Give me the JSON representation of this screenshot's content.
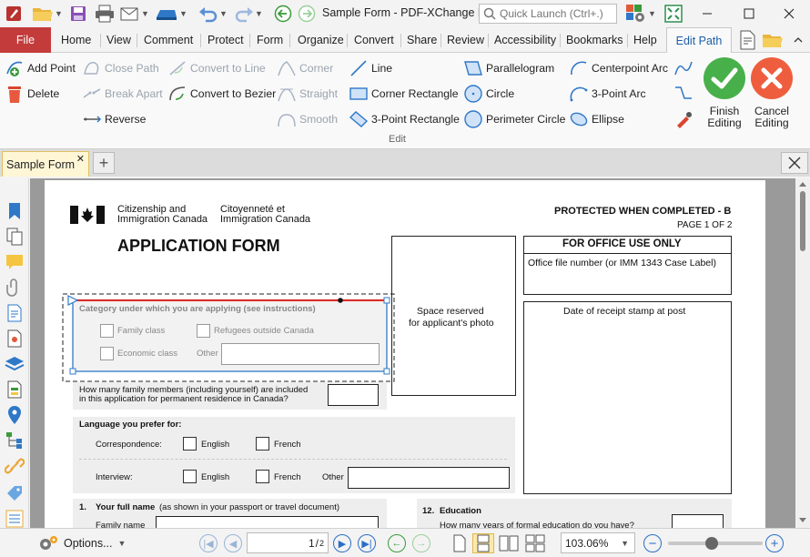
{
  "window": {
    "title": "Sample Form - PDF-XChange E...",
    "quick_launch_placeholder": "Quick Launch (Ctrl+.)"
  },
  "menu": {
    "file": "File",
    "tabs": [
      "Home",
      "View",
      "Comment",
      "Protect",
      "Form",
      "Organize",
      "Convert",
      "Share",
      "Review",
      "Accessibility",
      "Bookmarks",
      "Help"
    ],
    "active_tab": "Edit Path"
  },
  "ribbon": {
    "add_point": "Add Point",
    "delete": "Delete",
    "close_path": "Close Path",
    "break_apart": "Break Apart",
    "reverse": "Reverse",
    "convert_to_line": "Convert to Line",
    "convert_to_bezier": "Convert to Bezier",
    "corner": "Corner",
    "straight": "Straight",
    "smooth": "Smooth",
    "line": "Line",
    "corner_rectangle": "Corner Rectangle",
    "three_point_rectangle": "3-Point Rectangle",
    "parallelogram": "Parallelogram",
    "circle": "Circle",
    "perimeter_circle": "Perimeter Circle",
    "centerpoint_arc": "Centerpoint Arc",
    "three_point_arc": "3-Point Arc",
    "ellipse": "Ellipse",
    "finish_editing_1": "Finish",
    "finish_editing_2": "Editing",
    "cancel_editing_1": "Cancel",
    "cancel_editing_2": "Editing",
    "group_label": "Edit"
  },
  "document_tab": {
    "name": "Sample Form"
  },
  "page": {
    "agency_en_1": "Citizenship and",
    "agency_en_2": "Immigration Canada",
    "agency_fr_1": "Citoyenneté et",
    "agency_fr_2": "Immigration Canada",
    "protected": "PROTECTED WHEN COMPLETED - B",
    "page_of": "PAGE 1 OF 2",
    "form_title": "APPLICATION FORM",
    "office_use": "FOR OFFICE USE ONLY",
    "office_file": "Office file number (or IMM 1343 Case Label)",
    "receipt_stamp": "Date of receipt stamp at post",
    "photo_1": "Space reserved",
    "photo_2": "for applicant's photo",
    "category_label": "Category under which you are applying (see instructions)",
    "family_class": "Family class",
    "refugees": "Refugees outside Canada",
    "economic_class": "Economic class",
    "other": "Other",
    "family_members_1": "How many family members (including yourself) are included",
    "family_members_2": "in this application for permanent residence in Canada?",
    "language_label": "Language you prefer for:",
    "correspondence": "Correspondence:",
    "english": "English",
    "french": "French",
    "interview": "Interview:",
    "english2": "English",
    "french2": "French",
    "other2": "Other",
    "q1_num": "1.",
    "q1_bold": "Your full name",
    "q1_rest": "(as shown in your passport or travel document)",
    "family_name": "Family name",
    "q12_num": "12.",
    "q12_label": "Education",
    "q12_sub": "How many years of formal education do you have?"
  },
  "statusbar": {
    "options": "Options...",
    "current_page": "1",
    "total_pages": "2",
    "zoom": "103.06%",
    "zoom_level": 0.45
  }
}
